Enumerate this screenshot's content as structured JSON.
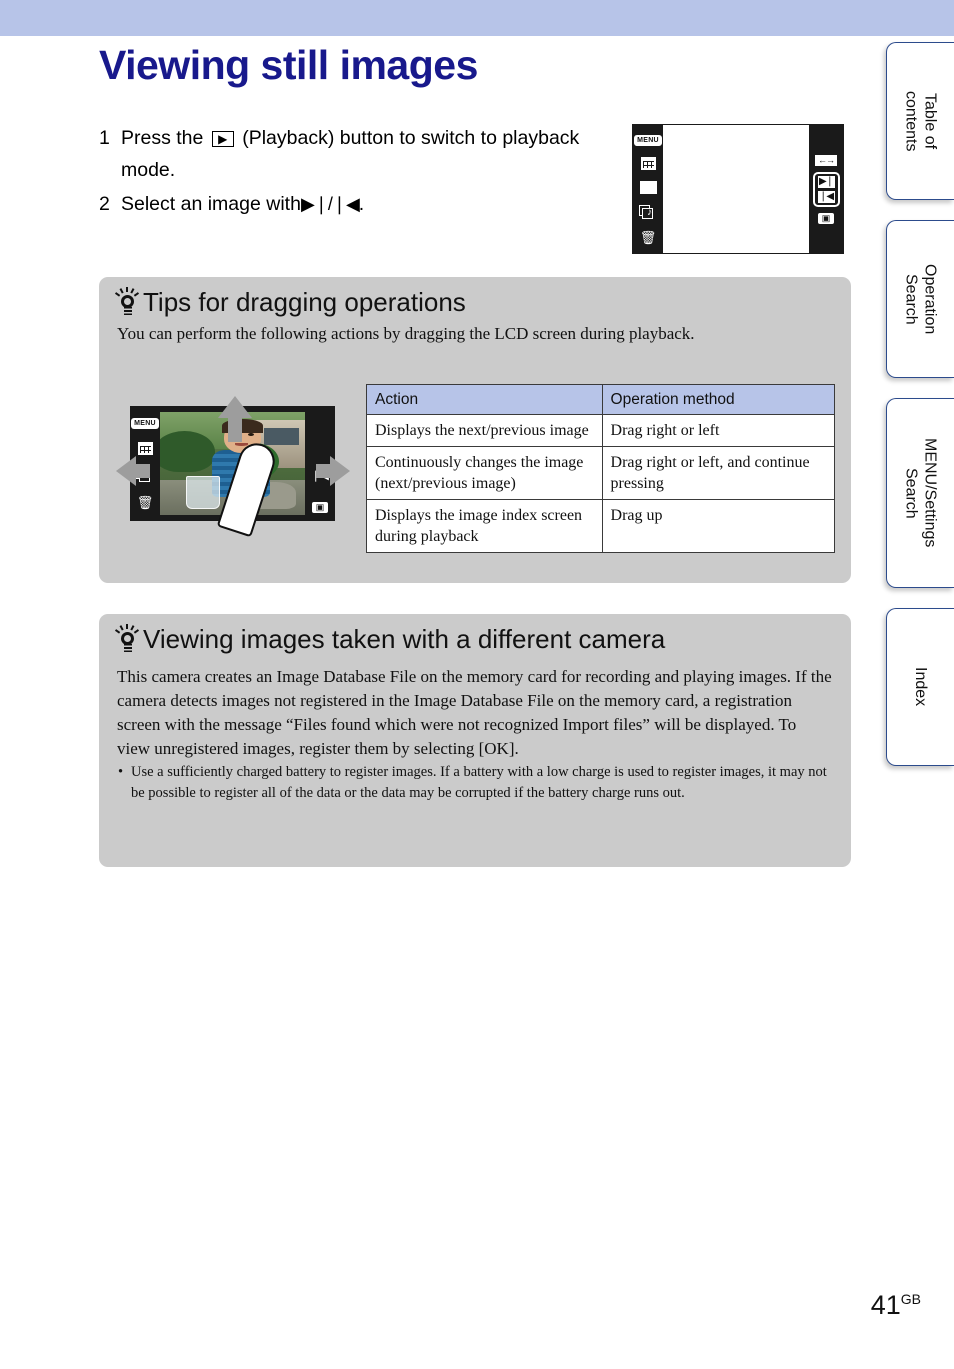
{
  "header": {
    "band_color": "#b7c4e8"
  },
  "page": {
    "title": "Viewing still images",
    "title_color": "#18198c",
    "number": "41",
    "region_code": "GB"
  },
  "steps": [
    {
      "num": "1",
      "text_before": "Press the",
      "key_glyph": "▶",
      "text_after": "(Playback) button to switch to playback mode."
    },
    {
      "num": "2",
      "text_before": "Select an image with",
      "key_glyph": "▶❘/❘◀",
      "text_after": "."
    }
  ],
  "lcd_top": {
    "left_icons": [
      {
        "name": "menu-icon",
        "label": "MENU"
      },
      {
        "name": "calendar-icon",
        "label": ""
      },
      {
        "name": "index-grid-icon",
        "label": ""
      },
      {
        "name": "slideshow-icon",
        "label": ""
      },
      {
        "name": "trash-icon",
        "label": ""
      }
    ],
    "right_icons": [
      {
        "name": "left-right-drag-icon",
        "label": "←→"
      },
      {
        "name": "next-image-button",
        "label": "▶❘"
      },
      {
        "name": "previous-image-button",
        "label": "❘◀"
      },
      {
        "name": "camera-mode-icon",
        "label": "■"
      }
    ]
  },
  "tips_dragging": {
    "heading": "Tips for dragging operations",
    "intro": "You can perform the following actions by dragging the LCD screen during playback.",
    "table": {
      "headers": [
        "Action",
        "Operation method"
      ],
      "header_bg": "#b7c4e8",
      "rows": [
        [
          "Displays the next/previous image",
          "Drag right or left"
        ],
        [
          "Continuously changes the image (next/previous image)",
          "Drag right or left, and continue pressing"
        ],
        [
          "Displays the image index screen during playback",
          "Drag up"
        ]
      ]
    },
    "illustration": {
      "left_icons": [
        "menu-icon",
        "calendar-icon",
        "slideshow-icon",
        "trash-icon"
      ],
      "right_icons": [
        "previous-image-icon",
        "camera-mode-icon"
      ],
      "arrows": [
        "up",
        "left",
        "right"
      ],
      "arrow_color": "#9d9d9d"
    }
  },
  "tips_different_camera": {
    "heading": "Viewing images taken with a different camera",
    "paragraph": "This camera creates an Image Database File on the memory card for recording and playing images. If the camera detects images not registered in the Image Database File on the memory card, a registration screen with the message “Files found which were not recognized Import files” will be displayed. To view unregistered images, register them by selecting [OK].",
    "bullets": [
      "Use a sufficiently charged battery to register images. If a battery with a low charge is used to register images, it may not be possible to register all of the data or the data may be corrupted if the battery charge runs out."
    ]
  },
  "side_tabs": [
    {
      "label": "Table of\ncontents"
    },
    {
      "label": "Operation\nSearch"
    },
    {
      "label": "MENU/Settings\nSearch"
    },
    {
      "label": "Index"
    }
  ]
}
